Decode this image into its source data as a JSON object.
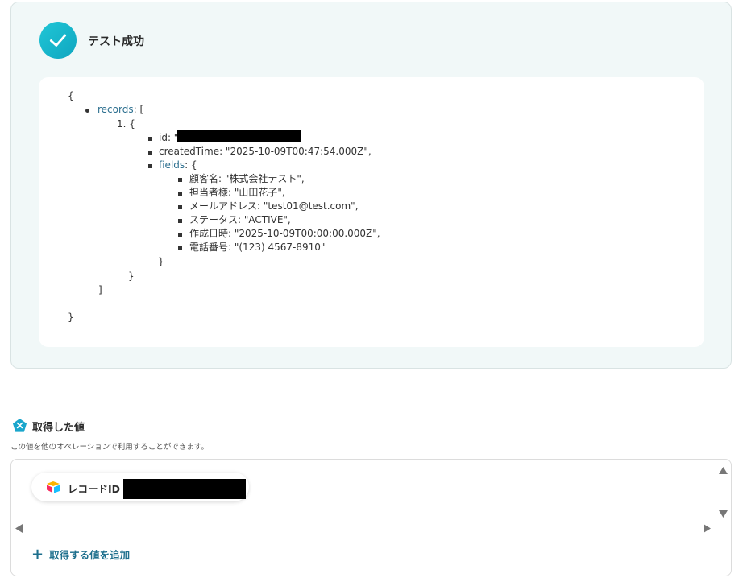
{
  "result": {
    "title": "テスト成功",
    "json_lines": {
      "open_brace": "{",
      "records_key": "records",
      "records_rest": ": [",
      "item_index": "1. {",
      "id_line": "id: \"",
      "created_line": "createdTime: \"2025-10-09T00:47:54.000Z\",",
      "fields_key": "fields",
      "fields_rest": ": {",
      "field_customer": "顧客名: \"株式会社テスト\",",
      "field_owner": "担当者様: \"山田花子\",",
      "field_email": "メールアドレス: \"test01@test.com\",",
      "field_status": "ステータス: \"ACTIVE\",",
      "field_created": "作成日時: \"2025-10-09T00:00:00.000Z\",",
      "field_phone": "電話番号: \"(123) 4567-8910\"",
      "close_fields": "}",
      "close_item": "}",
      "close_records": "]",
      "close_root": "}"
    }
  },
  "acquired": {
    "title": "取得した値",
    "description": "この値を他のオペレーションで利用することができます。",
    "chip_label": "レコードID",
    "add_label": "取得する値を追加",
    "add_icon": "+"
  },
  "colors": {
    "accent": "#1d6f8d",
    "success": "#12b5c9",
    "json_key": "#2c6f8f"
  }
}
